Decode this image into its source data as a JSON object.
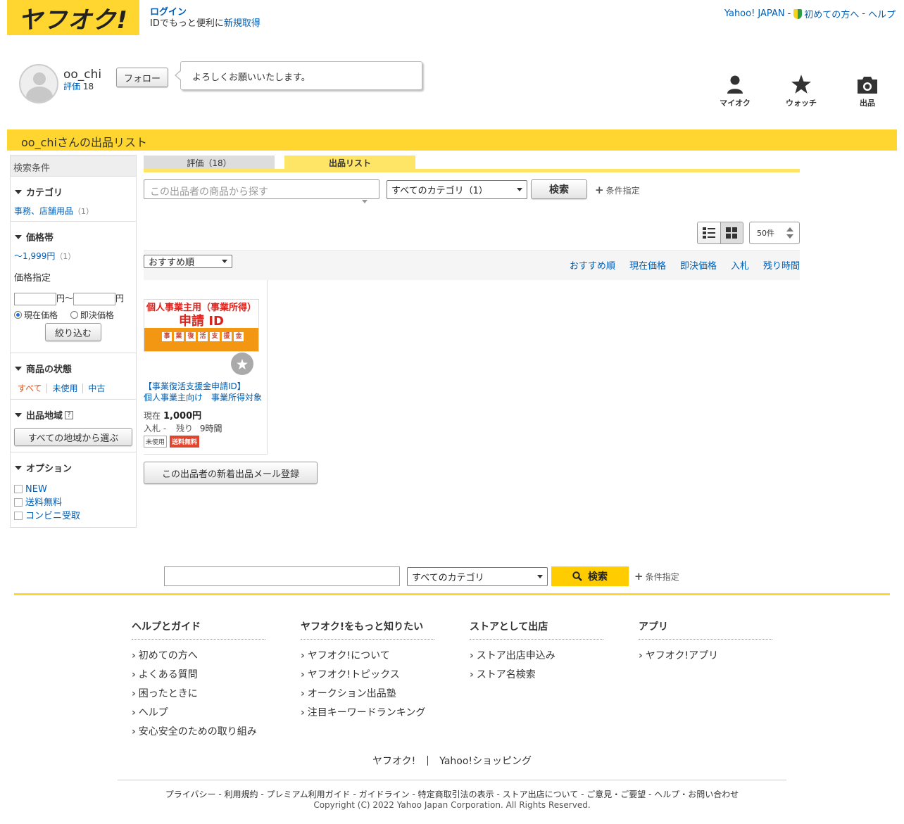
{
  "header": {
    "logo_text": "ヤフオク!",
    "login_label": "ログイン",
    "id_text": "IDでもっと便利に",
    "register_label": "新規取得",
    "top_links": [
      "Yahoo! JAPAN",
      "初めての方へ",
      "ヘルプ"
    ],
    "separator": "-"
  },
  "profile": {
    "username": "oo_chi",
    "rating_label": "評価",
    "rating_count": "18",
    "follow_label": "フォロー",
    "message": "よろしくお願いいたします。"
  },
  "quick_icons": [
    {
      "label": "マイオク",
      "icon": "person-icon"
    },
    {
      "label": "ウォッチ",
      "icon": "star-icon"
    },
    {
      "label": "出品",
      "icon": "camera-icon"
    }
  ],
  "page_title": "oo_chiさんの出品リスト",
  "sidebar": {
    "heading": "検索条件",
    "category_title": "カテゴリ",
    "category_link": "事務、店舗用品",
    "category_count": "（1）",
    "price_title": "価格帯",
    "price_link": "〜1,999円",
    "price_count": "（1）",
    "price_spec_label": "価格指定",
    "yen_to": "円～",
    "yen": "円",
    "radio_current": "現在価格",
    "radio_buynow": "即決価格",
    "narrow_button": "絞り込む",
    "condition_title": "商品の状態",
    "condition_options": [
      "すべて",
      "未使用",
      "中古"
    ],
    "region_title": "出品地域",
    "region_help": "?",
    "region_button": "すべての地域から選ぶ",
    "option_title": "オプション",
    "options": [
      "NEW",
      "送料無料",
      "コンビニ受取"
    ]
  },
  "tabs": {
    "rating": "評価（18）",
    "list": "出品リスト"
  },
  "search": {
    "placeholder": "この出品者の商品から探す",
    "category_selected": "すべてのカテゴリ（1）",
    "button": "検索",
    "condition_label": "条件指定"
  },
  "per_page": "50件",
  "sort": {
    "selected": "おすすめ順",
    "links": [
      "おすすめ順",
      "現在価格",
      "即決価格",
      "入札",
      "残り時間"
    ]
  },
  "product": {
    "thumb_line1": "個人事業主用（事業所得）",
    "thumb_line2": "申請 ID",
    "thumb_boxes": [
      "事",
      "業",
      "復",
      "活",
      "支",
      "援",
      "金"
    ],
    "title_line1": "【事業復活支援金申請ID】",
    "title_line2": "個人事業主向け　事業所得対象",
    "price_label": "現在",
    "price": "1,000円",
    "bid_label": "入札",
    "bid_value": "-",
    "remain_label": "残り",
    "remain_value": "9時間",
    "badge_condition": "未使用",
    "badge_shipping": "送料無料"
  },
  "mail_button": "この出品者の新着出品メール登録",
  "bottom_search": {
    "category_selected": "すべてのカテゴリ",
    "button": "検索",
    "condition_label": "条件指定"
  },
  "footer": {
    "columns": [
      {
        "title": "ヘルプとガイド",
        "items": [
          "初めての方へ",
          "よくある質問",
          "困ったときに",
          "ヘルプ",
          "安心安全のための取り組み"
        ]
      },
      {
        "title": "ヤフオク!をもっと知りたい",
        "items": [
          "ヤフオク!について",
          "ヤフオク!トピックス",
          "オークション出品塾",
          "注目キーワードランキング"
        ]
      },
      {
        "title": "ストアとして出店",
        "items": [
          "ストア出店申込み",
          "ストア名検索"
        ]
      },
      {
        "title": "アプリ",
        "items": [
          "ヤフオク!アプリ"
        ]
      }
    ],
    "brands": [
      "ヤフオク!",
      "Yahoo!ショッピング"
    ],
    "links": [
      "プライバシー",
      "利用規約",
      "プレミアム利用ガイド",
      "ガイドライン",
      "特定商取引法の表示",
      "ストア出店について",
      "ご意見・ご要望",
      "ヘルプ・お問い合わせ"
    ],
    "copyright": "Copyright (C) 2022 Yahoo Japan Corporation. All Rights Reserved."
  },
  "colors": {
    "brand_yellow": "#ffd62f",
    "link_blue": "#005fb5",
    "free_shipping_red": "#e0452f"
  }
}
